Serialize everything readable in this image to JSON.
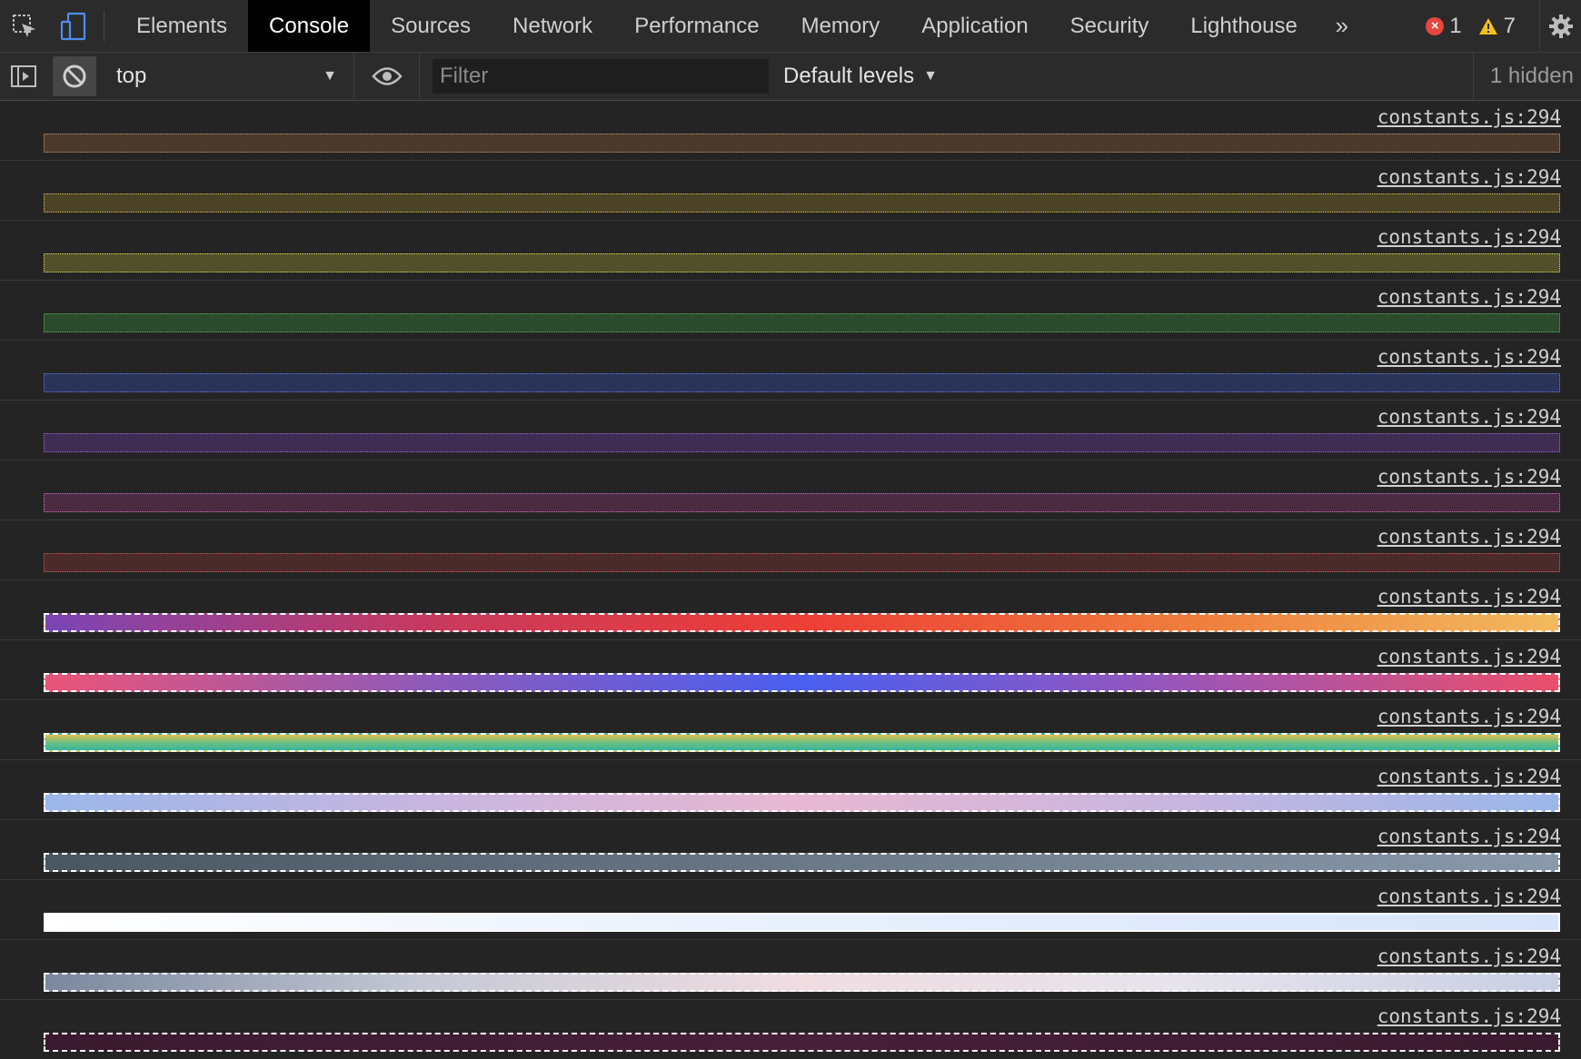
{
  "tabs": [
    {
      "label": "Elements",
      "active": false
    },
    {
      "label": "Console",
      "active": true
    },
    {
      "label": "Sources",
      "active": false
    },
    {
      "label": "Network",
      "active": false
    },
    {
      "label": "Performance",
      "active": false
    },
    {
      "label": "Memory",
      "active": false
    },
    {
      "label": "Application",
      "active": false
    },
    {
      "label": "Security",
      "active": false
    },
    {
      "label": "Lighthouse",
      "active": false
    }
  ],
  "more_tabs_glyph": "»",
  "counters": {
    "errors": "1",
    "warnings": "7"
  },
  "toolbar": {
    "context": "top",
    "filter_placeholder": "Filter",
    "filter_value": "",
    "levels": "Default levels",
    "hidden": "1 hidden"
  },
  "icons": {
    "inspect": "inspect-element-icon",
    "device": "device-toolbar-icon",
    "sidebar": "show-sidebar-icon",
    "clear": "clear-console-icon",
    "eye": "live-expression-eye-icon",
    "settings": "gear-icon",
    "error": "error-icon",
    "warning": "warning-icon"
  },
  "messages": [
    {
      "source": "constants.js:294",
      "style": "dotted",
      "bg": "#4a3a2c",
      "border": "#d59868"
    },
    {
      "source": "constants.js:294",
      "style": "dotted",
      "bg": "#4c4326",
      "border": "#e0c050"
    },
    {
      "source": "constants.js:294",
      "style": "dotted",
      "bg": "#50502a",
      "border": "#e4e25a"
    },
    {
      "source": "constants.js:294",
      "style": "dotted",
      "bg": "#2c4a2c",
      "border": "#5cb45a"
    },
    {
      "source": "constants.js:294",
      "style": "dotted",
      "bg": "#2b3358",
      "border": "#6a80e4"
    },
    {
      "source": "constants.js:294",
      "style": "dotted",
      "bg": "#3e2c52",
      "border": "#a070d8"
    },
    {
      "source": "constants.js:294",
      "style": "dotted",
      "bg": "#4a2b42",
      "border": "#d870c0"
    },
    {
      "source": "constants.js:294",
      "style": "dotted",
      "bg": "#4a2a2a",
      "border": "#d86060"
    },
    {
      "source": "constants.js:294",
      "style": "dashed",
      "border": "#ffffff",
      "gradient": [
        "#7b45b5",
        "#c6395f",
        "#ee3e36",
        "#ef7b3c",
        "#f2ba5e"
      ]
    },
    {
      "source": "constants.js:294",
      "style": "dashed",
      "border": "#ffffff",
      "gradient": [
        "#e95477",
        "#8f5ab8",
        "#4a5ff0",
        "#9955b8",
        "#eb4f6b"
      ]
    },
    {
      "source": "constants.js:294",
      "style": "dashed",
      "border": "#ffffff",
      "gradient_stripes": [
        "#e4bd54",
        "#6cc080",
        "#38b5a0"
      ]
    },
    {
      "source": "constants.js:294",
      "style": "dashed",
      "border": "#ffffff",
      "gradient": [
        "#9bb7ea",
        "#c7b5df",
        "#e8b8d2",
        "#c7b5df",
        "#9bb7ea"
      ]
    },
    {
      "source": "constants.js:294",
      "style": "dashed",
      "border": "#ffffff",
      "gradient": [
        "#4a5661",
        "#6a7887",
        "#8a99aa"
      ]
    },
    {
      "source": "constants.js:294",
      "style": "solid",
      "border": "#ffffff",
      "gradient": [
        "#ffffff",
        "#e8f0fd",
        "#d6e4fa"
      ]
    },
    {
      "source": "constants.js:294",
      "style": "dashed",
      "border": "#ffffff",
      "gradient": [
        "#7a879e",
        "#c5c9d5",
        "#f0dde2",
        "#e7e3ec",
        "#c8cfe3"
      ]
    },
    {
      "source": "constants.js:294",
      "style": "dashed",
      "border": "#ffffff",
      "gradient": [
        "#3a1a2e",
        "#461f38",
        "#3a1a2e"
      ]
    }
  ]
}
